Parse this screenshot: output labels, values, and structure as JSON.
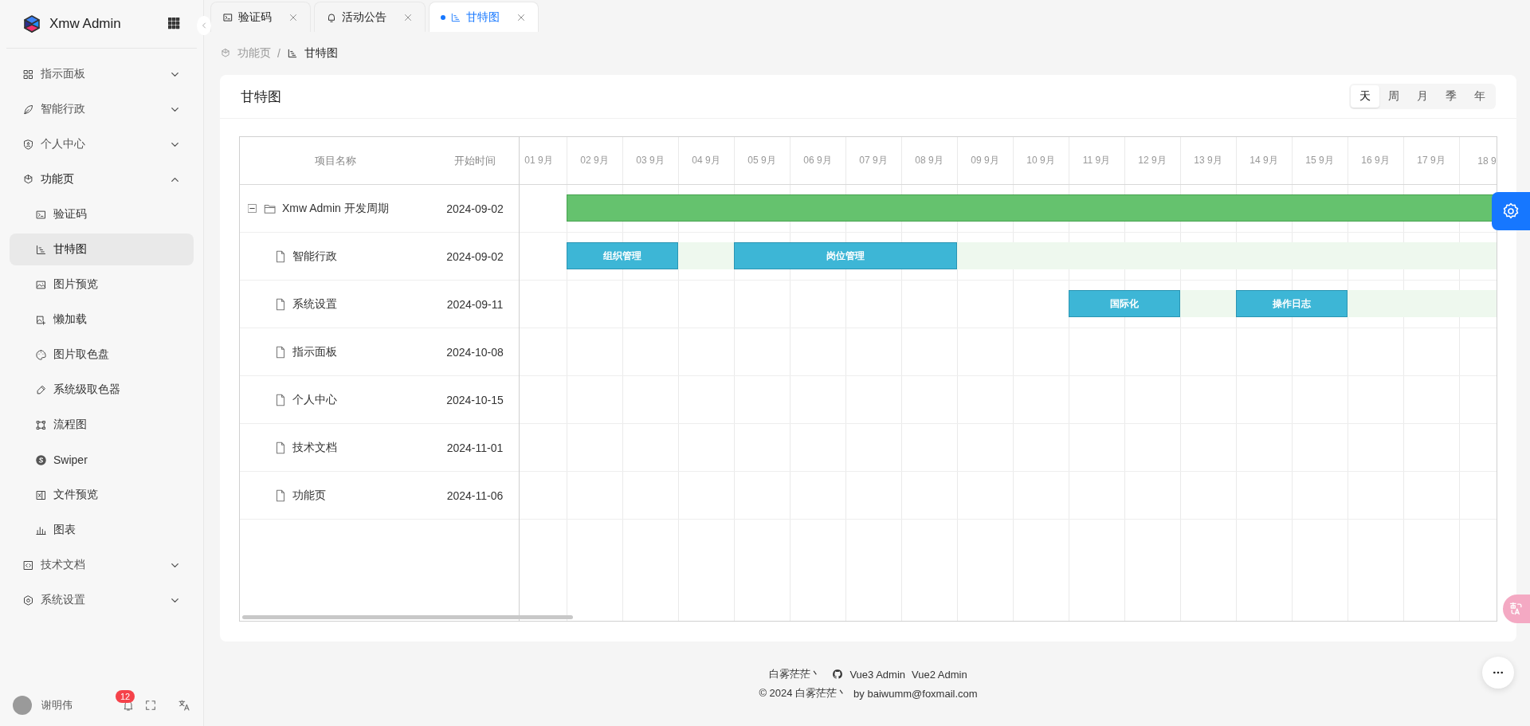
{
  "sidebar": {
    "logo_text": "Xmw Admin",
    "menu": [
      {
        "label": "指示面板",
        "expanded": false
      },
      {
        "label": "智能行政",
        "expanded": false
      },
      {
        "label": "个人中心",
        "expanded": false
      },
      {
        "label": "功能页",
        "expanded": true,
        "children": [
          {
            "label": "验证码",
            "selected": false
          },
          {
            "label": "甘特图",
            "selected": true
          },
          {
            "label": "图片预览",
            "selected": false
          },
          {
            "label": "懒加载",
            "selected": false
          },
          {
            "label": "图片取色盘",
            "selected": false
          },
          {
            "label": "系统级取色器",
            "selected": false
          },
          {
            "label": "流程图",
            "selected": false
          },
          {
            "label": "Swiper",
            "selected": false
          },
          {
            "label": "文件预览",
            "selected": false
          },
          {
            "label": "图表",
            "selected": false
          }
        ]
      },
      {
        "label": "技术文档",
        "expanded": false
      },
      {
        "label": "系统设置",
        "expanded": false
      }
    ],
    "user": {
      "name": "谢明伟",
      "notification_count": "12"
    }
  },
  "tabs": [
    {
      "label": "验证码",
      "selected": false
    },
    {
      "label": "活动公告",
      "selected": false
    },
    {
      "label": "甘特图",
      "selected": true
    }
  ],
  "breadcrumb": {
    "separator": "/",
    "items": [
      "功能页",
      "甘特图"
    ]
  },
  "card": {
    "title": "甘特图",
    "scales": [
      {
        "label": "天",
        "selected": true
      },
      {
        "label": "周",
        "selected": false
      },
      {
        "label": "月",
        "selected": false
      },
      {
        "label": "季",
        "selected": false
      },
      {
        "label": "年",
        "selected": false
      }
    ]
  },
  "gantt": {
    "columns": [
      "项目名称",
      "开始时间"
    ],
    "days": [
      "01 9月",
      "02 9月",
      "03 9月",
      "04 9月",
      "05 9月",
      "06 9月",
      "07 9月",
      "08 9月",
      "09 9月",
      "10 9月",
      "11 9月",
      "12 9月",
      "13 9月",
      "14 9月",
      "15 9月",
      "16 9月",
      "17 9月",
      "18 9"
    ],
    "rows": [
      {
        "name": "Xmw Admin 开发周期",
        "start": "2024-09-02",
        "expanded": true,
        "bars": [
          {
            "kind": "summary"
          }
        ],
        "children": [
          {
            "name": "智能行政",
            "start": "2024-09-02",
            "bars": [
              {
                "kind": "task",
                "label": "组织管理"
              },
              {
                "kind": "task",
                "label": "岗位管理"
              }
            ]
          },
          {
            "name": "系统设置",
            "start": "2024-09-11",
            "bars": [
              {
                "kind": "task",
                "label": "国际化"
              },
              {
                "kind": "task",
                "label": "操作日志"
              }
            ]
          },
          {
            "name": "指示面板",
            "start": "2024-10-08"
          },
          {
            "name": "个人中心",
            "start": "2024-10-15"
          },
          {
            "name": "技术文档",
            "start": "2024-11-01"
          },
          {
            "name": "功能页",
            "start": "2024-11-06"
          }
        ]
      }
    ]
  },
  "footer": {
    "author": "白雾茫茫丶",
    "links": [
      "Vue3 Admin",
      "Vue2 Admin"
    ],
    "copyright": "© 2024 白雾茫茫丶",
    "email": "by baiwumm@foxmail.com"
  }
}
